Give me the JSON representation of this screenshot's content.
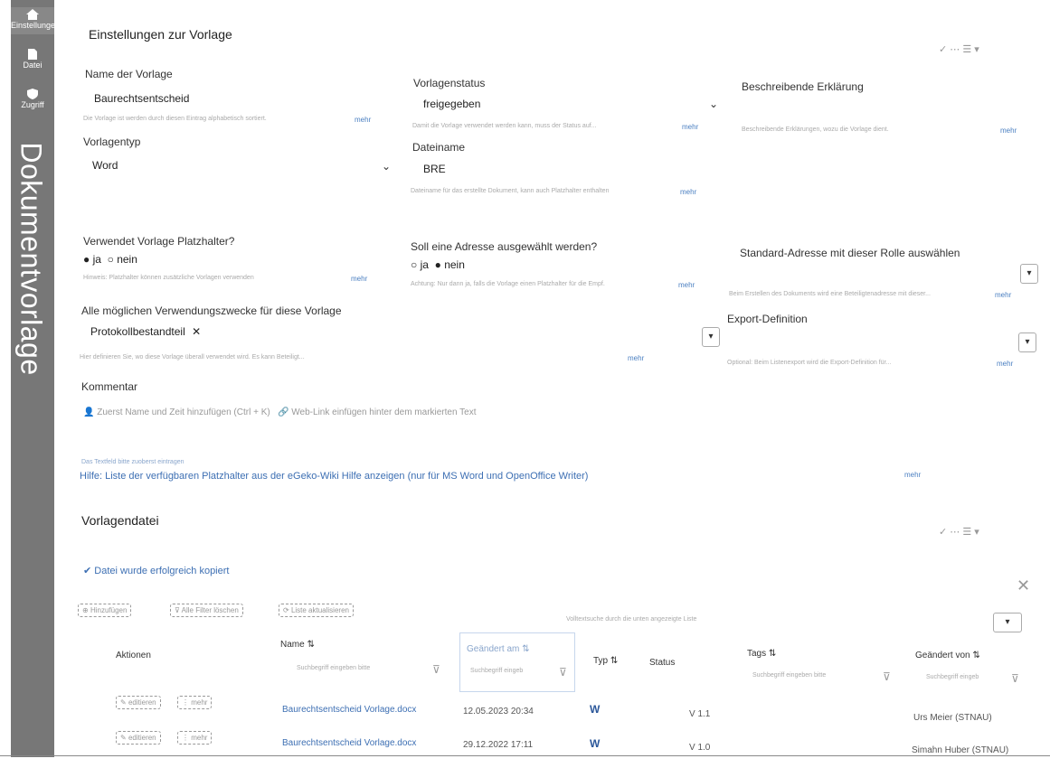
{
  "sidebar": {
    "items": [
      {
        "label": "Einstellungen",
        "icon": "home-icon"
      },
      {
        "label": "Datei",
        "icon": "file-icon"
      },
      {
        "label": "Zugriff",
        "icon": "shield-icon"
      }
    ],
    "title": "Dokumentvorlage"
  },
  "settings": {
    "title": "Einstellungen zur Vorlage",
    "name": {
      "label": "Name der Vorlage",
      "value": "Baurechtsentscheid",
      "hint": "Die Vorlage ist werden durch diesen Eintrag alphabetisch sortiert.",
      "more": "mehr"
    },
    "type": {
      "label": "Vorlagentyp",
      "value": "Word"
    },
    "status": {
      "label": "Vorlagenstatus",
      "value": "freigegeben",
      "hint": "Damit die Vorlage verwendet werden kann, muss der Status auf...",
      "more": "mehr"
    },
    "filename": {
      "label": "Dateiname",
      "value": "BRE",
      "hint": "Dateiname für das erstellte Dokument, kann auch Platzhalter enthalten",
      "more": "mehr"
    },
    "description": {
      "label": "Beschreibende Erklärung",
      "hint": "Beschreibende Erklärungen, wozu die Vorlage dient.",
      "more": "mehr"
    },
    "placeholders": {
      "label": "Verwendet Vorlage Platzhalter?",
      "options": [
        "ja",
        "nein"
      ],
      "selected": "ja",
      "hint": "Hinweis: Platzhalter können zusätzliche Vorlagen verwenden",
      "more": "mehr"
    },
    "address": {
      "label": "Soll eine Adresse ausgewählt werden?",
      "options": [
        "ja",
        "nein"
      ],
      "selected": "nein",
      "hint": "Achtung: Nur dann ja, falls die Vorlage einen Platzhalter für die Empf.",
      "more": "mehr"
    },
    "default_address": {
      "label": "Standard-Adresse mit dieser Rolle auswählen",
      "hint": "Beim Erstellen des Dokuments wird eine Beteiligtenadresse mit dieser...",
      "more": "mehr"
    },
    "purposes": {
      "label": "Alle möglichen Verwendungszwecke für diese Vorlage",
      "chip": "Protokollbestandteil",
      "hint": "Hier definieren Sie, wo diese Vorlage überall verwendet wird. Es kann Beteiligt...",
      "more": "mehr"
    },
    "export": {
      "label": "Export-Definition",
      "hint": "Optional: Beim Listenexport wird die Export-Definition für...",
      "more": "mehr"
    },
    "comment": {
      "label": "Kommentar",
      "hint1": "Zuerst Name und Zeit hinzufügen (Ctrl + K)",
      "hint2": "Web-Link einfügen hinter dem markierten Text",
      "helper": "Das Textfeld bitte zuoberst eintragen",
      "help_link": "Hilfe: Liste der verfügbaren Platzhalter aus der eGeko-Wiki Hilfe anzeigen (nur für MS Word und OpenOffice Writer)",
      "more": "mehr"
    },
    "header_controls": "✓  ⋯  ☰ ▾"
  },
  "files": {
    "title": "Vorlagendatei",
    "success": "Datei wurde erfolgreich kopiert",
    "toolbar": {
      "add": "Hinzufügen",
      "reset": "Alle Filter löschen",
      "refresh": "Liste aktualisieren"
    },
    "search_hint": "Volltextsuche durch die unten angezeigte Liste",
    "columns": {
      "actions": "Aktionen",
      "name": "Name",
      "changed": "Geändert am",
      "type": "Typ",
      "status": "Status",
      "tags": "Tags",
      "changed_by": "Geändert von"
    },
    "filter_placeholder": "Suchbegriff eingeben bitte",
    "filter_placeholder_short": "Suchbegriff eingeb",
    "row_actions": {
      "edit": "editieren",
      "more": "mehr"
    },
    "rows": [
      {
        "name": "Baurechtsentscheid Vorlage.docx",
        "changed": "12.05.2023 20:34",
        "status": "V 1.1",
        "changed_by": "Urs Meier (STNAU)"
      },
      {
        "name": "Baurechtsentscheid Vorlage.docx",
        "changed": "29.12.2022 17:11",
        "status": "V 1.0",
        "changed_by": "Simahn Huber (STNAU)"
      }
    ]
  }
}
